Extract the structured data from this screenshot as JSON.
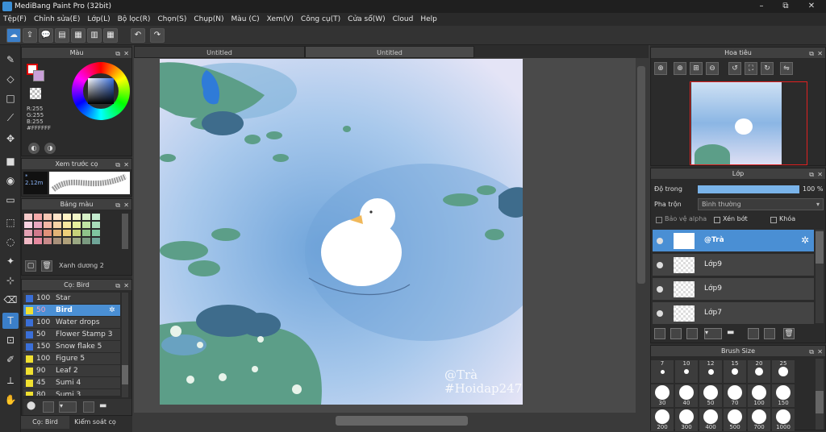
{
  "window": {
    "title": "MediBang Paint Pro (32bit)",
    "min": "–",
    "max": "⧉",
    "close": "✕"
  },
  "menu": [
    "Tệp(F)",
    "Chỉnh sửa(E)",
    "Lớp(L)",
    "Bộ lọc(R)",
    "Chọn(S)",
    "Chụp(N)",
    "Màu (C)",
    "Xem(V)",
    "Công cụ(T)",
    "Cửa sổ(W)",
    "Cloud",
    "Help"
  ],
  "color_panel": {
    "title": "Màu",
    "r": "R:255",
    "g": "G:255",
    "b": "B:255",
    "hex": "#FFFFFF"
  },
  "brush_preview": {
    "title": "Xem trước cọ",
    "size": "* 2.12m"
  },
  "palette": {
    "title": "Bảng màu",
    "name": "Xanh dương 2",
    "colors": [
      "#f4c9c9",
      "#f5a9a9",
      "#f7c6b3",
      "#fde3c8",
      "#fff3c4",
      "#f1f5c7",
      "#d6f0c6",
      "#c4eccf",
      "#f7d1e0",
      "#e9a8c0",
      "#f3b8a6",
      "#f6d3a6",
      "#f9e9a0",
      "#e7ef9e",
      "#c0e3a3",
      "#a9ddb9",
      "#e2a0b2",
      "#d07a8c",
      "#e1927a",
      "#e3b477",
      "#efd07a",
      "#c6d27a",
      "#8fc38a",
      "#7fc5a0",
      "#f0b8c4",
      "#e68aa0",
      "#c98a8a",
      "#a8907a",
      "#b0a07a",
      "#9aa883",
      "#7a9a80",
      "#6fa598"
    ]
  },
  "brush_panel": {
    "title": "Cọ: Bird",
    "items": [
      {
        "size": "100",
        "name": "Star",
        "color": "#3a6fd8"
      },
      {
        "size": "50",
        "name": "Bird",
        "color": "#f0e030"
      },
      {
        "size": "100",
        "name": "Water drops",
        "color": "#3a6fd8"
      },
      {
        "size": "50",
        "name": "Flower Stamp 3",
        "color": "#3a6fd8"
      },
      {
        "size": "150",
        "name": "Snow flake 5",
        "color": "#3a6fd8"
      },
      {
        "size": "100",
        "name": "Figure 5",
        "color": "#f0e030"
      },
      {
        "size": "90",
        "name": "Leaf 2",
        "color": "#f0e030"
      },
      {
        "size": "45",
        "name": "Sumi 4",
        "color": "#f0e030"
      },
      {
        "size": "80",
        "name": "Sumi 3",
        "color": "#f0e030"
      }
    ]
  },
  "bottom_tabs": [
    "Cọ: Bird",
    "Kiểm soát cọ"
  ],
  "doc_tabs": [
    "Untitled",
    "Untitled"
  ],
  "artwork": {
    "watermark1": "@Trà",
    "watermark2": "#Hoidap247"
  },
  "navigator": {
    "title": "Hoa tiêu"
  },
  "layers": {
    "title": "Lớp",
    "opacity_label": "Độ trong",
    "opacity_value": "100 %",
    "opacity": 1.0,
    "blend_label": "Pha trộn",
    "blend_value": "Bình thường",
    "protect_alpha": "Bảo vệ alpha",
    "clipping": "Xén bớt",
    "lock": "Khóa",
    "items": [
      {
        "name": "@Trà",
        "selected": true
      },
      {
        "name": "Lớp9"
      },
      {
        "name": "Lớp9"
      },
      {
        "name": "Lớp7"
      }
    ]
  },
  "brush_size": {
    "title": "Brush Size",
    "row1": [
      "7",
      "10",
      "12",
      "15",
      "20",
      "25"
    ],
    "row2": [
      "30",
      "40",
      "50",
      "70",
      "100",
      "150"
    ],
    "row3": [
      "200",
      "300",
      "400",
      "500",
      "700",
      "1000"
    ]
  }
}
